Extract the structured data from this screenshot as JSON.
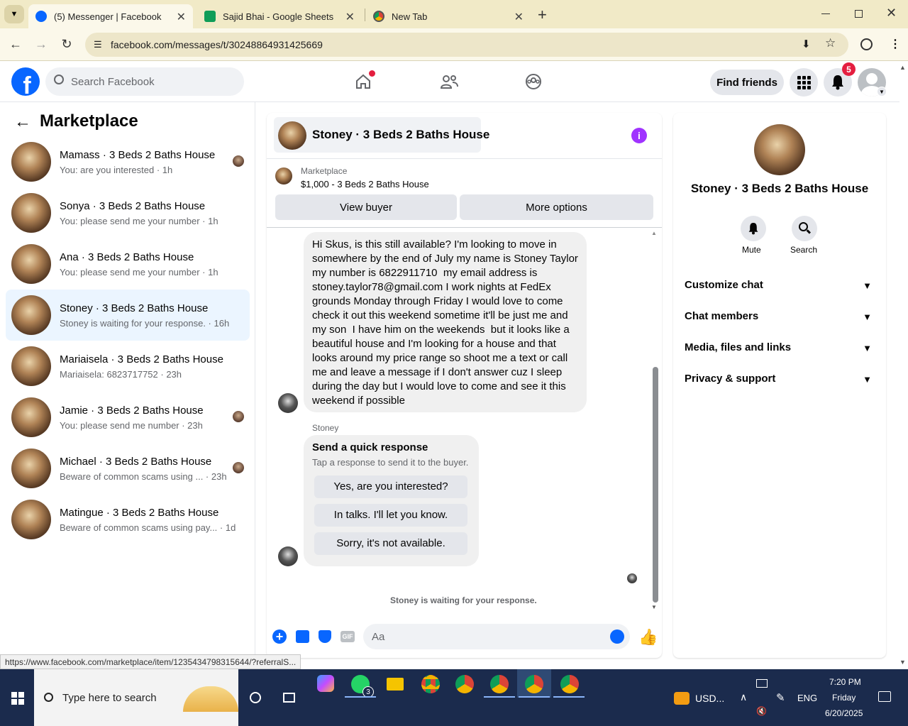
{
  "browser": {
    "tabs": [
      {
        "title": "(5) Messenger | Facebook",
        "active": true
      },
      {
        "title": "Sajid Bhai - Google Sheets",
        "active": false
      },
      {
        "title": "New Tab",
        "active": false
      }
    ],
    "url": "facebook.com/messages/t/30248864931425669",
    "status_url": "https://www.facebook.com/marketplace/item/1235434798315644/?referralS..."
  },
  "fb": {
    "search_placeholder": "Search Facebook",
    "find_friends": "Find friends",
    "notif_count": "5"
  },
  "left": {
    "title": "Marketplace",
    "conversations": [
      {
        "name": "Mamass · 3 Beds 2 Baths House",
        "preview": "You: are you interested · 1h",
        "selected": false,
        "mini": true
      },
      {
        "name": "Sonya · 3 Beds 2 Baths House",
        "preview": "You: please send me your number · 1h",
        "selected": false,
        "mini": false
      },
      {
        "name": "Ana · 3 Beds 2 Baths House",
        "preview": "You: please send me your number · 1h",
        "selected": false,
        "mini": false
      },
      {
        "name": "Stoney · 3 Beds 2 Baths House",
        "preview": "Stoney is waiting for your response. · 16h",
        "selected": true,
        "mini": false
      },
      {
        "name": "Mariaisela · 3 Beds 2 Baths House",
        "preview": "Mariaisela: 6823717752 · 23h",
        "selected": false,
        "mini": false
      },
      {
        "name": "Jamie · 3 Beds 2 Baths House",
        "preview": "You: please send me number · 23h",
        "selected": false,
        "mini": true
      },
      {
        "name": "Michael · 3 Beds 2 Baths House",
        "preview": "Beware of common scams using ...  · 23h",
        "selected": false,
        "mini": true
      },
      {
        "name": "Matingue · 3 Beds 2 Baths House",
        "preview": "Beware of common scams using pay...  · 1d",
        "selected": false,
        "mini": false
      }
    ]
  },
  "chat": {
    "title": "Stoney · 3 Beds 2 Baths House",
    "listing_label": "Marketplace",
    "listing_price": "$1,000 - 3 Beds 2 Baths House",
    "view_buyer": "View buyer",
    "more_options": "More options",
    "message_lines": [
      "Hi Skus, is this still available? I'm looking to move in",
      "somewhere by the end of July my name is Stoney Taylor",
      "my number is 6822911710  my email address is",
      "stoney.taylor78@gmail.com I work nights at FedEx",
      "grounds Monday through Friday I would love to come",
      "check it out this weekend sometime it'll be just me and",
      "my son  I have him on the weekends  but it looks like a",
      "beautiful house and I'm looking for a house and that",
      "looks around my price range so shoot me a text or call",
      "me and leave a message if I don't answer cuz I sleep",
      "during the day but I would love to come and see it this",
      "weekend if possible"
    ],
    "sender_label": "Stoney",
    "quick_title": "Send a quick response",
    "quick_sub": "Tap a response to send it to the buyer.",
    "quick_replies": [
      "Yes, are you interested?",
      "In talks. I'll let you know.",
      "Sorry, it's not available."
    ],
    "waiting_text": "Stoney is waiting for your response.",
    "composer_placeholder": "Aa",
    "gif_label": "GIF"
  },
  "right": {
    "name": "Stoney · 3 Beds 2 Baths House",
    "mute": "Mute",
    "search": "Search",
    "options": [
      "Customize chat",
      "Chat members",
      "Media, files and links",
      "Privacy & support"
    ]
  },
  "taskbar": {
    "search_placeholder": "Type here to search",
    "whatsapp_badge": "3",
    "weather": "USD...",
    "lang": "ENG",
    "time": "7:20 PM",
    "day": "Friday",
    "date": "6/20/2025"
  },
  "colors": {
    "fb_blue": "#0866ff",
    "messenger_purple": "#a033ff",
    "notif_red": "#e41e3f",
    "selected_bg": "#ebf5ff"
  }
}
